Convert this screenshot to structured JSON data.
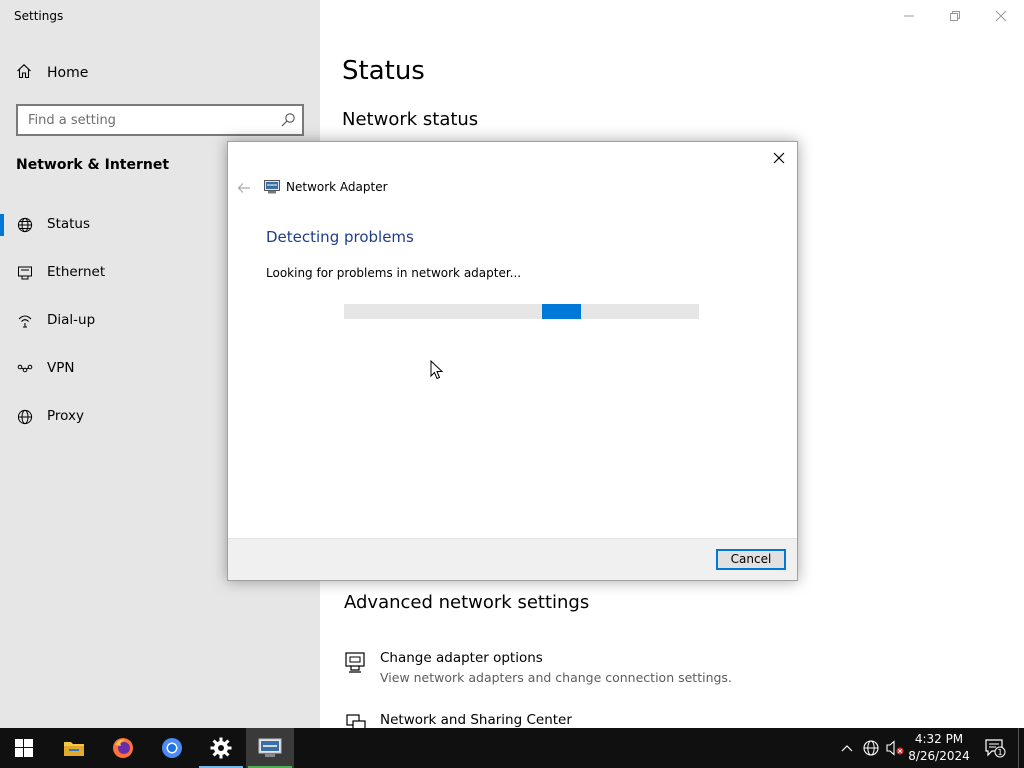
{
  "window": {
    "title": "Settings"
  },
  "sidebar": {
    "home_label": "Home",
    "search_placeholder": "Find a setting",
    "section_title": "Network & Internet",
    "items": [
      {
        "label": "Status",
        "icon": "home-network-icon",
        "selected": true
      },
      {
        "label": "Ethernet",
        "icon": "ethernet-icon",
        "selected": false
      },
      {
        "label": "Dial-up",
        "icon": "dialup-icon",
        "selected": false
      },
      {
        "label": "VPN",
        "icon": "vpn-icon",
        "selected": false
      },
      {
        "label": "Proxy",
        "icon": "globe-icon",
        "selected": false
      }
    ]
  },
  "main": {
    "title": "Status",
    "subtitle": "Network status",
    "advanced_title": "Advanced network settings",
    "advanced_items": [
      {
        "label": "Change adapter options",
        "description": "View network adapters and change connection settings.",
        "icon": "adapter-monitor-icon"
      },
      {
        "label": "Network and Sharing Center",
        "description": "",
        "icon": "sharing-center-icon"
      }
    ]
  },
  "dialog": {
    "app_name": "Network Adapter",
    "heading": "Detecting problems",
    "message": "Looking for problems in network adapter...",
    "progress": {
      "style": "indeterminate",
      "segment_start_fraction": 0.557,
      "segment_width_fraction": 0.11
    },
    "cancel_label": "Cancel"
  },
  "taskbar": {
    "apps": [
      {
        "name": "file-explorer",
        "active": false
      },
      {
        "name": "firefox",
        "active": false
      },
      {
        "name": "chromium",
        "active": false
      },
      {
        "name": "settings",
        "active": false,
        "running": true
      },
      {
        "name": "network-troubleshooter",
        "active": true,
        "running": true
      }
    ],
    "time": "4:32 PM",
    "date": "8/26/2024",
    "notification_count": "1"
  },
  "colors": {
    "accent": "#0078d7",
    "sidebar_bg": "#e6e6e6",
    "dialog_heading": "#1e3e8a",
    "taskbar_bg": "#101010"
  }
}
